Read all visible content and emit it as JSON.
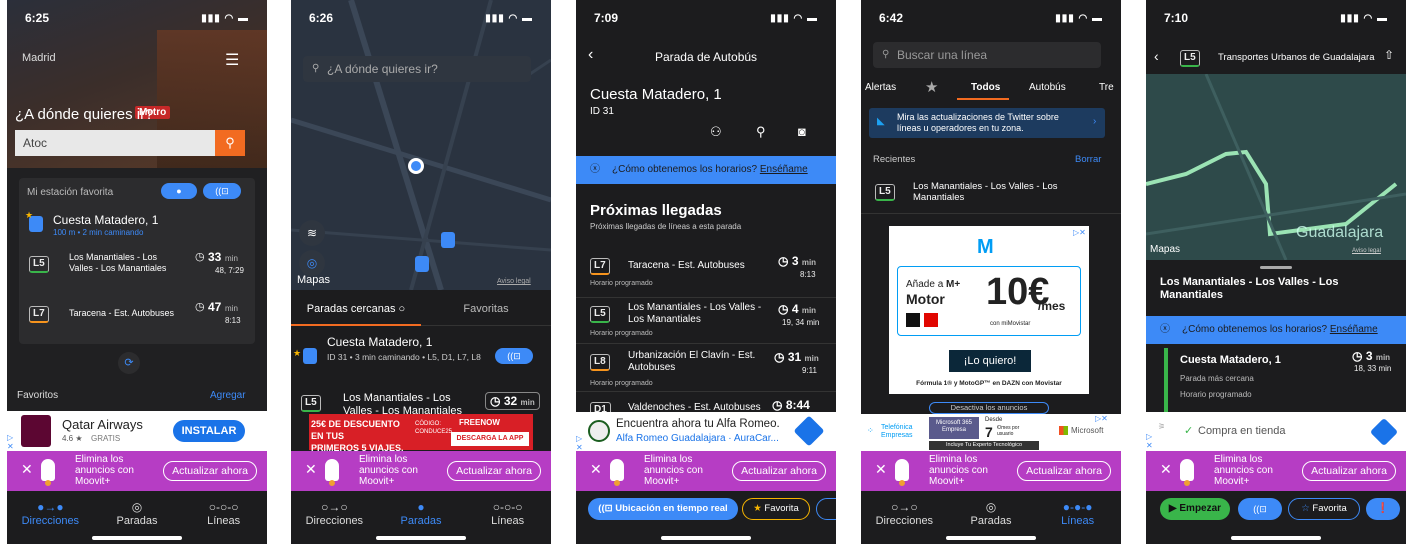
{
  "s1": {
    "time": "6:25",
    "city": "Madrid",
    "question": "¿A dónde quieres ir?",
    "input": "Atoc",
    "fav_label": "Mi estación favorita",
    "stop_name": "Cuesta Matadero, 1",
    "stop_sub": "100 m • 2 min caminando",
    "rows": [
      {
        "line": "L5",
        "dest": "Los Manantiales - Los Valles - Los Manantiales",
        "eta": "33",
        "unit": "min",
        "next": "48, 7:29"
      },
      {
        "line": "L7",
        "dest": "Taracena - Est. Autobuses",
        "eta": "47",
        "unit": "min",
        "next": "8:13"
      }
    ],
    "favs": "Favoritos",
    "add": "Agregar",
    "ad_name": "Qatar Airways",
    "ad_rating": "4.6 ★",
    "ad_free": "GRATIS",
    "ad_btn": "INSTALAR",
    "moovit_text": "Elimina los anuncios con Moovit+",
    "moovit_btn": "Actualizar ahora",
    "tabs": [
      "Direcciones",
      "Paradas",
      "Líneas"
    ],
    "active_tab": 0,
    "metro": "Metro"
  },
  "s2": {
    "time": "6:26",
    "search": "¿A dónde quieres ir?",
    "maps": "Mapas",
    "legal": "Aviso legal",
    "tab_near": "Paradas cercanas",
    "tab_fav": "Favoritas",
    "stop_name": "Cuesta Matadero, 1",
    "stop_sub": "ID 31 • 3 min caminando • L5, D1, L7, L8",
    "row_line": "L5",
    "row_dest": "Los Manantiales - Los Valles - Los Manantiales",
    "row_eta": "32",
    "row_unit": "min",
    "ad_left1": "25€ DE DESCUENTO EN TUS",
    "ad_left2": "PRIMEROS 5 VIAJES.",
    "ad_code1": "CÓDIGO:",
    "ad_code2": "CONDUCE25",
    "ad_brand": "FREENOW",
    "ad_cta": "DESCARGA LA APP",
    "moovit_text": "Elimina los anuncios con Moovit+",
    "moovit_btn": "Actualizar ahora",
    "tabs": [
      "Direcciones",
      "Paradas",
      "Líneas"
    ],
    "active_tab": 1
  },
  "s3": {
    "time": "7:09",
    "title": "Parada de Autobús",
    "stop_name": "Cuesta Matadero, 1",
    "stop_id": "ID 31",
    "info": "¿Cómo obtenemos los horarios?",
    "info_link": "Enséñame",
    "heading": "Próximas llegadas",
    "sub": "Próximas llegadas de líneas a esta parada",
    "rows": [
      {
        "line": "L7",
        "dest": "Taracena - Est. Autobuses",
        "eta": "3",
        "unit": "min",
        "next": "8:13",
        "note": "Horario programado",
        "color": "orange"
      },
      {
        "line": "L5",
        "dest": "Los Manantiales - Los Valles - Los Manantiales",
        "eta": "4",
        "unit": "min",
        "next": "19, 34 min",
        "note": "Horario programado",
        "color": "green"
      },
      {
        "line": "L8",
        "dest": "Urbanización El Clavín - Est. Autobuses",
        "eta": "31",
        "unit": "min",
        "next": "9:11",
        "note": "Horario programado",
        "color": "orange"
      },
      {
        "line": "D1",
        "dest": "Valdenoches - Est. Autobuses",
        "eta": "8:44",
        "unit": "",
        "next": "",
        "note": "",
        "color": "red"
      }
    ],
    "ad_title": "Encuentra ahora tu Alfa Romeo.",
    "ad_sub": "Alfa Romeo Guadalajara · AuraCar...",
    "moovit_text": "Elimina los anuncios con Moovit+",
    "moovit_btn": "Actualizar ahora",
    "btn_live": "Ubicación en tiempo real",
    "btn_fav": "Favorita"
  },
  "s4": {
    "time": "6:42",
    "search": "Buscar una línea",
    "tabs": [
      "Alertas",
      "★",
      "Todos",
      "Autobús",
      "Tre"
    ],
    "twitter": "Mira las actualizaciones de Twitter sobre líneas u operadores en tu zona.",
    "recent": "Recientes",
    "clear": "Borrar",
    "line": "L5",
    "dest": "Los Manantiales - Los Valles - Los Manantiales",
    "ad_add": "Añade a",
    "ad_plus": "M+",
    "ad_motor": "Motor",
    "ad_price": "10€",
    "ad_mes": "/mes",
    "ad_con": "con miMovistar",
    "ad_btn": "¡Lo quiero!",
    "ad_foot": "Fórmula 1® y MotoGP™ en DAZN con Movistar",
    "deact": "Desactiva los anuncios",
    "tel1": "Telefónica",
    "tel2": "Empresas",
    "ms365": "Microsoft 365 Empresa",
    "ms_from": "Desde",
    "ms_price": "7",
    "ms_unit": "€/mes por usuario",
    "ms_incl": "Incluye Tu Experto Tecnológico",
    "ms_brand": "Microsoft",
    "moovit_text": "Elimina los anuncios con Moovit+",
    "moovit_btn": "Actualizar ahora",
    "bottabs": [
      "Direcciones",
      "Paradas",
      "Líneas"
    ],
    "active_tab": 2
  },
  "s5": {
    "time": "7:10",
    "line": "L5",
    "title": "Transportes Urbanos de Guadalajara",
    "maps": "Mapas",
    "legal": "Aviso legal",
    "city": "Guadalajara",
    "route": "Los Manantiales - Los Valles - Los Manantiales",
    "info": "¿Cómo obtenemos los horarios?",
    "info_link": "Enséñame",
    "stop": "Cuesta Matadero, 1",
    "stop_sub1": "Parada más cercana",
    "stop_sub2": "Horario programado",
    "eta": "3",
    "unit": "min",
    "next": "18, 33 min",
    "ad_text": "Compra en tienda",
    "moovit_text": "Elimina los anuncios con Moovit+",
    "moovit_btn": "Actualizar ahora",
    "start": "Empezar",
    "fav": "Favorita"
  }
}
